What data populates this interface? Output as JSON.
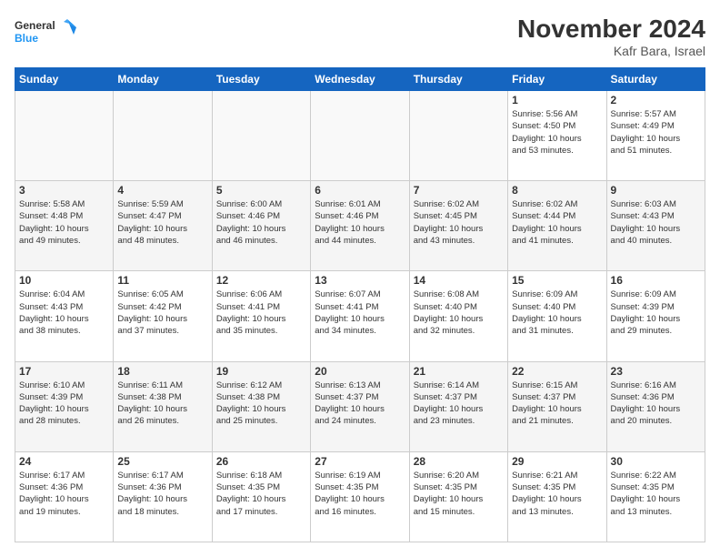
{
  "header": {
    "logo_general": "General",
    "logo_blue": "Blue",
    "month_title": "November 2024",
    "location": "Kafr Bara, Israel"
  },
  "weekdays": [
    "Sunday",
    "Monday",
    "Tuesday",
    "Wednesday",
    "Thursday",
    "Friday",
    "Saturday"
  ],
  "weeks": [
    [
      {
        "day": "",
        "info": ""
      },
      {
        "day": "",
        "info": ""
      },
      {
        "day": "",
        "info": ""
      },
      {
        "day": "",
        "info": ""
      },
      {
        "day": "",
        "info": ""
      },
      {
        "day": "1",
        "info": "Sunrise: 5:56 AM\nSunset: 4:50 PM\nDaylight: 10 hours\nand 53 minutes."
      },
      {
        "day": "2",
        "info": "Sunrise: 5:57 AM\nSunset: 4:49 PM\nDaylight: 10 hours\nand 51 minutes."
      }
    ],
    [
      {
        "day": "3",
        "info": "Sunrise: 5:58 AM\nSunset: 4:48 PM\nDaylight: 10 hours\nand 49 minutes."
      },
      {
        "day": "4",
        "info": "Sunrise: 5:59 AM\nSunset: 4:47 PM\nDaylight: 10 hours\nand 48 minutes."
      },
      {
        "day": "5",
        "info": "Sunrise: 6:00 AM\nSunset: 4:46 PM\nDaylight: 10 hours\nand 46 minutes."
      },
      {
        "day": "6",
        "info": "Sunrise: 6:01 AM\nSunset: 4:46 PM\nDaylight: 10 hours\nand 44 minutes."
      },
      {
        "day": "7",
        "info": "Sunrise: 6:02 AM\nSunset: 4:45 PM\nDaylight: 10 hours\nand 43 minutes."
      },
      {
        "day": "8",
        "info": "Sunrise: 6:02 AM\nSunset: 4:44 PM\nDaylight: 10 hours\nand 41 minutes."
      },
      {
        "day": "9",
        "info": "Sunrise: 6:03 AM\nSunset: 4:43 PM\nDaylight: 10 hours\nand 40 minutes."
      }
    ],
    [
      {
        "day": "10",
        "info": "Sunrise: 6:04 AM\nSunset: 4:43 PM\nDaylight: 10 hours\nand 38 minutes."
      },
      {
        "day": "11",
        "info": "Sunrise: 6:05 AM\nSunset: 4:42 PM\nDaylight: 10 hours\nand 37 minutes."
      },
      {
        "day": "12",
        "info": "Sunrise: 6:06 AM\nSunset: 4:41 PM\nDaylight: 10 hours\nand 35 minutes."
      },
      {
        "day": "13",
        "info": "Sunrise: 6:07 AM\nSunset: 4:41 PM\nDaylight: 10 hours\nand 34 minutes."
      },
      {
        "day": "14",
        "info": "Sunrise: 6:08 AM\nSunset: 4:40 PM\nDaylight: 10 hours\nand 32 minutes."
      },
      {
        "day": "15",
        "info": "Sunrise: 6:09 AM\nSunset: 4:40 PM\nDaylight: 10 hours\nand 31 minutes."
      },
      {
        "day": "16",
        "info": "Sunrise: 6:09 AM\nSunset: 4:39 PM\nDaylight: 10 hours\nand 29 minutes."
      }
    ],
    [
      {
        "day": "17",
        "info": "Sunrise: 6:10 AM\nSunset: 4:39 PM\nDaylight: 10 hours\nand 28 minutes."
      },
      {
        "day": "18",
        "info": "Sunrise: 6:11 AM\nSunset: 4:38 PM\nDaylight: 10 hours\nand 26 minutes."
      },
      {
        "day": "19",
        "info": "Sunrise: 6:12 AM\nSunset: 4:38 PM\nDaylight: 10 hours\nand 25 minutes."
      },
      {
        "day": "20",
        "info": "Sunrise: 6:13 AM\nSunset: 4:37 PM\nDaylight: 10 hours\nand 24 minutes."
      },
      {
        "day": "21",
        "info": "Sunrise: 6:14 AM\nSunset: 4:37 PM\nDaylight: 10 hours\nand 23 minutes."
      },
      {
        "day": "22",
        "info": "Sunrise: 6:15 AM\nSunset: 4:37 PM\nDaylight: 10 hours\nand 21 minutes."
      },
      {
        "day": "23",
        "info": "Sunrise: 6:16 AM\nSunset: 4:36 PM\nDaylight: 10 hours\nand 20 minutes."
      }
    ],
    [
      {
        "day": "24",
        "info": "Sunrise: 6:17 AM\nSunset: 4:36 PM\nDaylight: 10 hours\nand 19 minutes."
      },
      {
        "day": "25",
        "info": "Sunrise: 6:17 AM\nSunset: 4:36 PM\nDaylight: 10 hours\nand 18 minutes."
      },
      {
        "day": "26",
        "info": "Sunrise: 6:18 AM\nSunset: 4:35 PM\nDaylight: 10 hours\nand 17 minutes."
      },
      {
        "day": "27",
        "info": "Sunrise: 6:19 AM\nSunset: 4:35 PM\nDaylight: 10 hours\nand 16 minutes."
      },
      {
        "day": "28",
        "info": "Sunrise: 6:20 AM\nSunset: 4:35 PM\nDaylight: 10 hours\nand 15 minutes."
      },
      {
        "day": "29",
        "info": "Sunrise: 6:21 AM\nSunset: 4:35 PM\nDaylight: 10 hours\nand 13 minutes."
      },
      {
        "day": "30",
        "info": "Sunrise: 6:22 AM\nSunset: 4:35 PM\nDaylight: 10 hours\nand 13 minutes."
      }
    ]
  ]
}
